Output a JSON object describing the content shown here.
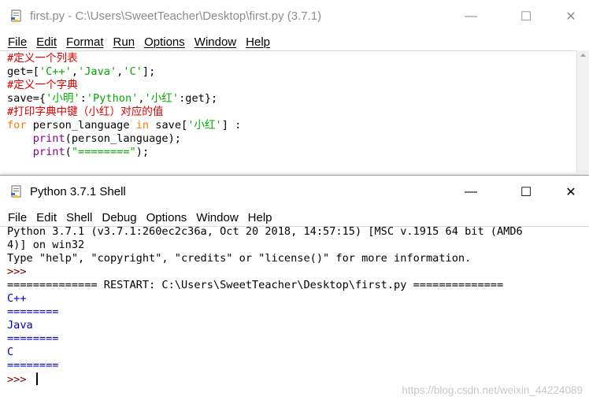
{
  "editor": {
    "title": "first.py - C:\\Users\\SweetTeacher\\Desktop\\first.py (3.7.1)",
    "menu": [
      "File",
      "Edit",
      "Format",
      "Run",
      "Options",
      "Window",
      "Help"
    ],
    "code": {
      "l1": "#定义一个列表",
      "l2a": "get=[",
      "l2b": "'C++'",
      "l2c": ",",
      "l2d": "'Java'",
      "l2e": ",",
      "l2f": "'C'",
      "l2g": "];",
      "l3": "#定义一个字典",
      "l4a": "save={",
      "l4b": "'小明'",
      "l4c": ":",
      "l4d": "'Python'",
      "l4e": ",",
      "l4f": "'小红'",
      "l4g": ":get};",
      "l5": "#打印字典中键（小红）对应的值",
      "l6a": "for",
      "l6b": " person_language ",
      "l6c": "in",
      "l6d": " save[",
      "l6e": "'小红'",
      "l6f": "] :",
      "l7a": "    ",
      "l7b": "print",
      "l7c": "(person_language);",
      "l8a": "    ",
      "l8b": "print",
      "l8c": "(",
      "l8d": "\"========\"",
      "l8e": ");"
    }
  },
  "shell": {
    "title": "Python 3.7.1 Shell",
    "menu": [
      "File",
      "Edit",
      "Shell",
      "Debug",
      "Options",
      "Window",
      "Help"
    ],
    "lines": {
      "banner1": "Python 3.7.1 (v3.7.1:260ec2c36a, Oct 20 2018, 14:57:15) [MSC v.1915 64 bit (AMD6",
      "banner2": "4)] on win32",
      "banner3": "Type \"help\", \"copyright\", \"credits\" or \"license()\" for more information.",
      "prompt1": ">>> ",
      "restart": "============== RESTART: C:\\Users\\SweetTeacher\\Desktop\\first.py ==============",
      "out1": "C++",
      "out2": "========",
      "out3": "Java",
      "out4": "========",
      "out5": "C",
      "out6": "========",
      "prompt2": ">>> "
    }
  },
  "window_controls": {
    "minimize": "—",
    "maximize": "☐",
    "close": "✕"
  },
  "watermark": "https://blog.csdn.net/weixin_44224089",
  "colors": {
    "comment": "#dd0000",
    "keyword": "#ff7700",
    "string": "#00aa00",
    "builtin": "#900090",
    "output": "#0000c0"
  }
}
